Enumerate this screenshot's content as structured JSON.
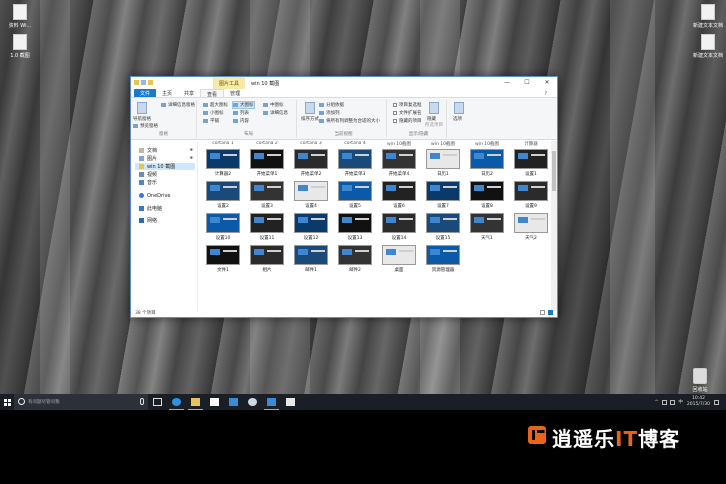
{
  "desktop": {
    "left_icons": [
      "资料 Wi...",
      "1.0 截图"
    ],
    "right_icons": [
      "新建文本文档",
      "新建文本文档"
    ],
    "recycle_bin": "回收站"
  },
  "explorer": {
    "context_tab": "图片工具",
    "title": "win 10 截图",
    "window_buttons": [
      "—",
      "☐",
      "✕"
    ],
    "tabs": [
      "文件",
      "主页",
      "共享",
      "查看",
      "管理"
    ],
    "help": "?",
    "ribbon": {
      "pane_group": {
        "name": "窗格",
        "nav_pane": "导航窗格",
        "preview_pane": "预览窗格",
        "details_pane": "详细信息窗格"
      },
      "layout_group": {
        "name": "布局",
        "items": [
          "超大图标",
          "大图标",
          "中图标",
          "小图标",
          "列表",
          "详细信息",
          "平铺",
          "内容"
        ]
      },
      "current_view_group": {
        "name": "当前视图",
        "sort_by": "排序方式",
        "group_by": "分组依据",
        "add_columns": "添加列",
        "fit_columns": "将所有列调整为合适的大小"
      },
      "show_hide_group": {
        "name": "显示/隐藏",
        "checkboxes": [
          "项目复选框",
          "文件扩展名",
          "隐藏的项目"
        ],
        "hide_selected": "隐藏",
        "hide_selected_2": "所选项目"
      },
      "options": "选项"
    },
    "nav": {
      "items": [
        {
          "label": "文档",
          "pinned": true
        },
        {
          "label": "图片",
          "pinned": true
        },
        {
          "label": "win 10 截图",
          "pinned": false,
          "selected": true
        },
        {
          "label": "视频",
          "pinned": false
        },
        {
          "label": "音乐",
          "pinned": false
        },
        {
          "label": "OneDrive",
          "pinned": false
        },
        {
          "label": "此电脑",
          "pinned": false
        },
        {
          "label": "网络",
          "pinned": false
        }
      ]
    },
    "header_labels": [
      "cortana 1",
      "cortana 2",
      "cortana 3",
      "cortana 4",
      "win 10截图",
      "win 10截图",
      "win 10截图",
      "计算器"
    ],
    "files": [
      [
        "计算器2",
        "开始菜单1",
        "开始菜单2",
        "开始菜单3",
        "开始菜单4",
        "日历1",
        "日历2",
        "设置1"
      ],
      [
        "设置2",
        "设置3",
        "设置4",
        "设置5",
        "设置6",
        "设置7",
        "设置8",
        "设置9"
      ],
      [
        "设置10",
        "设置11",
        "设置12",
        "设置13",
        "设置14",
        "设置15",
        "天气1",
        "天气2"
      ],
      [
        "文件1",
        "相片",
        "邮件1",
        "邮件2",
        "桌面",
        "资源管理器"
      ]
    ],
    "status": "38 个项目"
  },
  "taskbar": {
    "search_placeholder": "有问题尽管问我",
    "clock_time": "10:42",
    "clock_date": "2015/7/30",
    "tray_lang": "中"
  },
  "brand": {
    "text_a": "IT",
    "text_prefix": "逍遥乐",
    "text_suffix": "博客"
  }
}
